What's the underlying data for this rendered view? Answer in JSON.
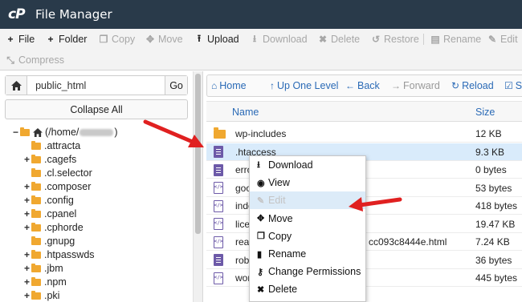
{
  "header": {
    "logo": "cP",
    "title": "File Manager"
  },
  "toolbar": {
    "row1": [
      {
        "label": "File",
        "icon": "+",
        "enabled": true
      },
      {
        "label": "Folder",
        "icon": "+",
        "enabled": true
      },
      {
        "label": "Copy",
        "icon": "❐",
        "enabled": false
      },
      {
        "label": "Move",
        "icon": "✥",
        "enabled": false
      },
      {
        "label": "Upload",
        "icon": "⭱",
        "enabled": true
      },
      {
        "label": "Download",
        "icon": "⭳",
        "enabled": false
      },
      {
        "label": "Delete",
        "icon": "✖",
        "enabled": false
      },
      {
        "label": "Restore",
        "icon": "↺",
        "enabled": false
      },
      {
        "label": "Rename",
        "icon": "▤",
        "enabled": false
      },
      {
        "label": "Edit",
        "icon": "✎",
        "enabled": false
      }
    ],
    "row2": [
      {
        "label": "Compress",
        "icon": "⤡",
        "enabled": false
      }
    ]
  },
  "left_panel": {
    "path_value": "public_html",
    "go_label": "Go",
    "collapse_label": "Collapse All",
    "tree": [
      {
        "label": "(/home/",
        "suffix": ")",
        "toggle": "−",
        "root": true
      },
      {
        "label": ".attracta",
        "toggle": ""
      },
      {
        "label": ".cagefs",
        "toggle": "+"
      },
      {
        "label": ".cl.selector",
        "toggle": ""
      },
      {
        "label": ".composer",
        "toggle": "+"
      },
      {
        "label": ".config",
        "toggle": "+"
      },
      {
        "label": ".cpanel",
        "toggle": "+"
      },
      {
        "label": ".cphorde",
        "toggle": "+"
      },
      {
        "label": ".gnupg",
        "toggle": ""
      },
      {
        "label": ".htpasswds",
        "toggle": "+"
      },
      {
        "label": ".jbm",
        "toggle": "+"
      },
      {
        "label": ".npm",
        "toggle": "+"
      },
      {
        "label": ".pki",
        "toggle": "+"
      }
    ]
  },
  "right_panel": {
    "nav": [
      {
        "label": "Home",
        "icon": "⌂",
        "enabled": true
      },
      {
        "label": "Up One Level",
        "icon": "↑",
        "enabled": true
      },
      {
        "label": "Back",
        "icon": "←",
        "enabled": true
      },
      {
        "label": "Forward",
        "icon": "→",
        "enabled": false
      },
      {
        "label": "Reload",
        "icon": "↻",
        "enabled": true
      },
      {
        "label": "Se",
        "icon": "☑",
        "enabled": true
      }
    ],
    "columns": {
      "name": "Name",
      "size": "Size"
    },
    "files": [
      {
        "name": "wp-includes",
        "size": "12 KB",
        "type": "folder"
      },
      {
        "name": ".htaccess",
        "size": "9.3 KB",
        "type": "text",
        "selected": true
      },
      {
        "name": "erro",
        "size": "0 bytes",
        "type": "text"
      },
      {
        "name": "goo",
        "size": "53 bytes",
        "type": "code"
      },
      {
        "name": "inde",
        "size": "418 bytes",
        "type": "code"
      },
      {
        "name": "lice",
        "size": "19.47 KB",
        "type": "code"
      },
      {
        "name": "rea",
        "name_tail": "cc093c8444e.html",
        "size": "7.24 KB",
        "type": "code"
      },
      {
        "name": "rob",
        "size": "36 bytes",
        "type": "text"
      },
      {
        "name": "wor",
        "size": "445 bytes",
        "type": "code"
      }
    ]
  },
  "context_menu": {
    "items": [
      {
        "label": "Download",
        "icon": "⭳",
        "enabled": true
      },
      {
        "label": "View",
        "icon": "◉",
        "enabled": true
      },
      {
        "label": "Edit",
        "icon": "✎",
        "enabled": false
      },
      {
        "label": "Move",
        "icon": "✥",
        "enabled": true
      },
      {
        "label": "Copy",
        "icon": "❐",
        "enabled": true
      },
      {
        "label": "Rename",
        "icon": "▮",
        "enabled": true
      },
      {
        "label": "Change Permissions",
        "icon": "⚷",
        "enabled": true
      },
      {
        "label": "Delete",
        "icon": "✖",
        "enabled": true
      }
    ]
  },
  "colors": {
    "header_bg": "#293a4a",
    "link": "#2a6ab6",
    "selected_row": "#d9ebfb",
    "arrow": "#e02020",
    "folder": "#f0a830",
    "file_icon": "#6d5aa8"
  }
}
